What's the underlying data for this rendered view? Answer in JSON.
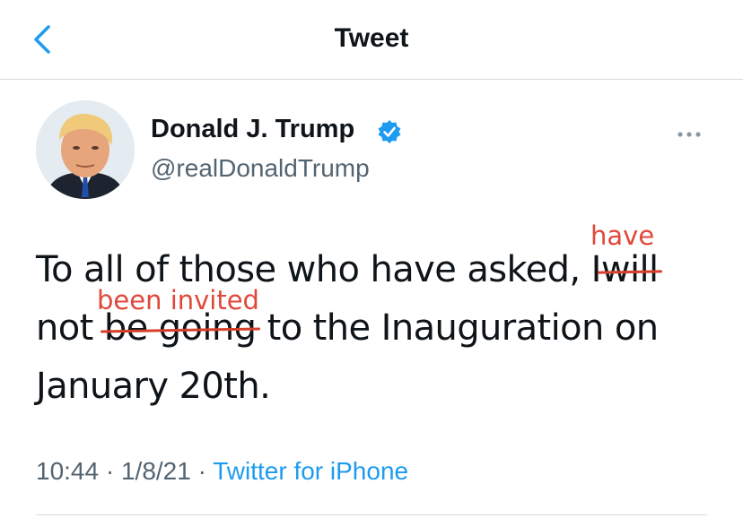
{
  "header": {
    "title": "Tweet"
  },
  "author": {
    "name": "Donald J. Trump",
    "handle": "@realDonaldTrump"
  },
  "tweet": {
    "line1_before": "To all of those who have asked, I",
    "line1_struck": "will",
    "line2_before": "not",
    "line2_struck": "be going",
    "line2_after": "to the Inauguration on",
    "line3": "January 20th."
  },
  "annotations": {
    "above_will": "have",
    "above_be_going": "been invited",
    "color": "#e0483a"
  },
  "meta": {
    "time": "10:44",
    "separator": "·",
    "date": "1/8/21",
    "source": "Twitter for iPhone"
  },
  "icons": {
    "back": "chevron-left-icon",
    "verified": "verified-badge-icon",
    "more": "more-horizontal-icon"
  },
  "colors": {
    "accent": "#1d9bf0",
    "secondary_text": "#536471",
    "strike": "#d6402b"
  }
}
